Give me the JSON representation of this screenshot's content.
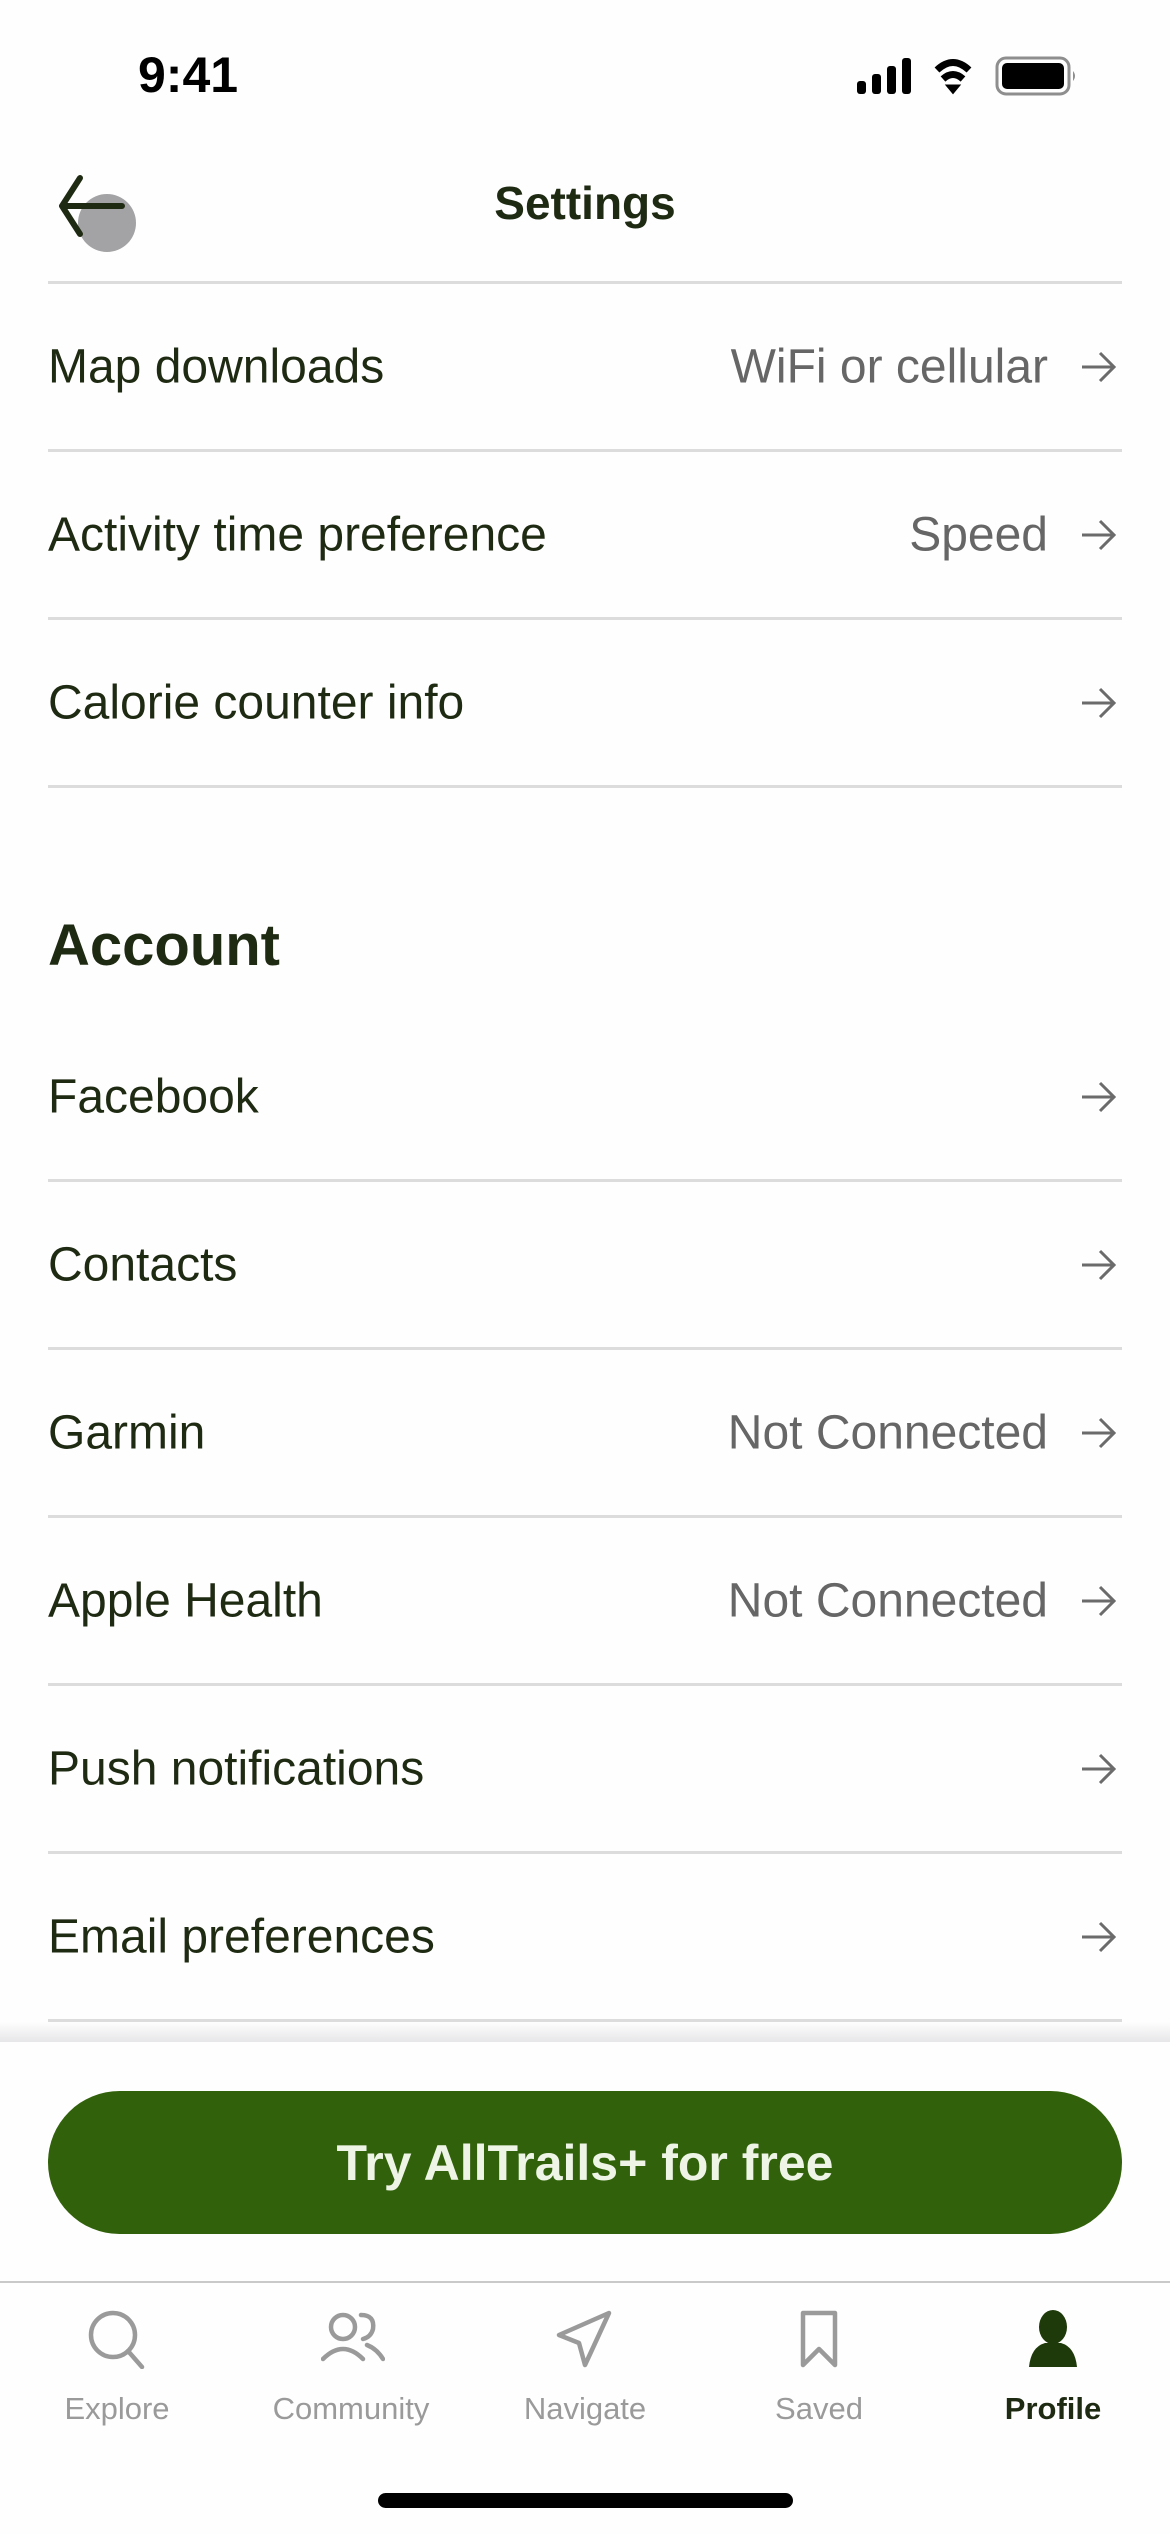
{
  "status_bar": {
    "time": "9:41",
    "icons": [
      "cellular-signal-icon",
      "wifi-icon",
      "battery-icon"
    ]
  },
  "nav": {
    "title": "Settings",
    "back_icon": "arrow-left-icon"
  },
  "preferences_rows": [
    {
      "label": "Map downloads",
      "value": "WiFi or cellular"
    },
    {
      "label": "Activity time preference",
      "value": "Speed"
    },
    {
      "label": "Calorie counter info",
      "value": ""
    }
  ],
  "account_section": {
    "heading": "Account",
    "rows": [
      {
        "label": "Facebook",
        "value": ""
      },
      {
        "label": "Contacts",
        "value": ""
      },
      {
        "label": "Garmin",
        "value": "Not Connected"
      },
      {
        "label": "Apple Health",
        "value": "Not Connected"
      },
      {
        "label": "Push notifications",
        "value": ""
      },
      {
        "label": "Email preferences",
        "value": ""
      }
    ]
  },
  "cta": {
    "label": "Try AllTrails+ for free"
  },
  "tab_bar": {
    "tabs": [
      {
        "label": "Explore",
        "icon": "search-icon",
        "active": false
      },
      {
        "label": "Community",
        "icon": "community-icon",
        "active": false
      },
      {
        "label": "Navigate",
        "icon": "navigate-icon",
        "active": false
      },
      {
        "label": "Saved",
        "icon": "bookmark-icon",
        "active": false
      },
      {
        "label": "Profile",
        "icon": "profile-icon",
        "active": true
      }
    ]
  },
  "colors": {
    "brand_green": "#31610a",
    "text_primary": "#1f2a13",
    "text_secondary": "#666666",
    "tab_inactive": "#9a9a9a"
  }
}
